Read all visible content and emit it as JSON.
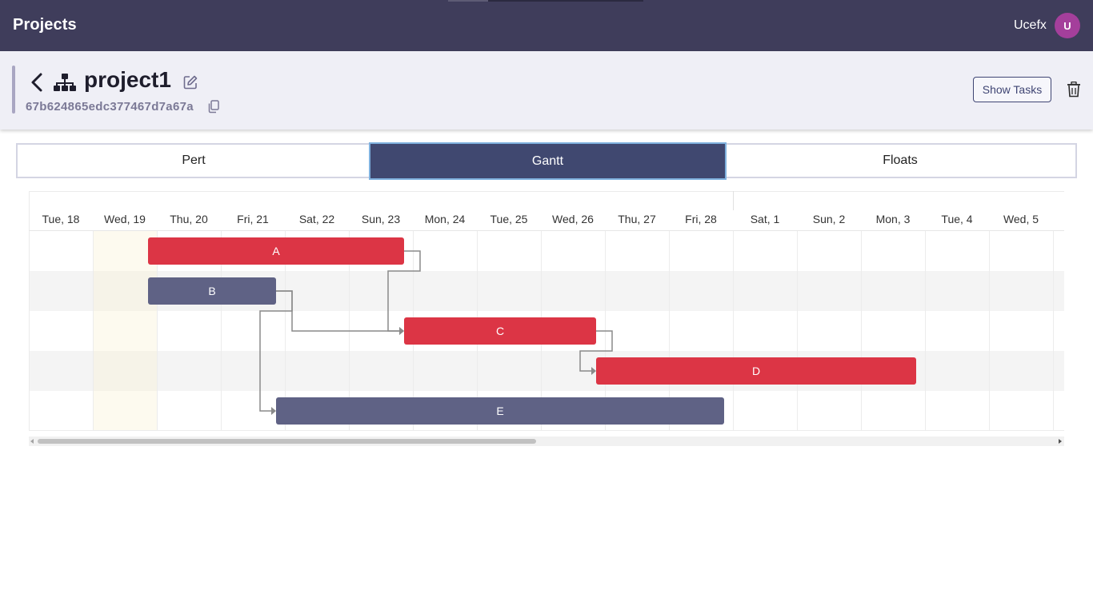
{
  "app": {
    "title": "Projects",
    "user_name": "Ucefx",
    "avatar_initial": "U",
    "avatar_color": "#a43f9b",
    "bar_color": "#3f3d5b"
  },
  "project": {
    "name": "project1",
    "id": "67b624865edc377467d7a67a",
    "show_tasks_label": "Show Tasks"
  },
  "tabs": [
    {
      "label": "Pert",
      "active": false
    },
    {
      "label": "Gantt",
      "active": true
    },
    {
      "label": "Floats",
      "active": false
    }
  ],
  "gantt": {
    "dates": [
      "Tue, 18",
      "Wed, 19",
      "Thu, 20",
      "Fri, 21",
      "Sat, 22",
      "Sun, 23",
      "Mon, 24",
      "Tue, 25",
      "Wed, 26",
      "Thu, 27",
      "Fri, 28",
      "Sat, 1",
      "Sun, 2",
      "Mon, 3",
      "Tue, 4",
      "Wed, 5"
    ],
    "today_column": 1,
    "critical_color": "#dc3545",
    "normal_color": "#5f6285",
    "tasks": [
      {
        "label": "A",
        "start_day": 1.8,
        "duration_days": 4,
        "critical": true
      },
      {
        "label": "B",
        "start_day": 1.8,
        "duration_days": 2,
        "critical": false
      },
      {
        "label": "C",
        "start_day": 5.8,
        "duration_days": 3,
        "critical": true
      },
      {
        "label": "D",
        "start_day": 8.8,
        "duration_days": 5,
        "critical": true
      },
      {
        "label": "E",
        "start_day": 3.8,
        "duration_days": 7,
        "critical": false
      }
    ],
    "dependencies": [
      {
        "from": "A",
        "to": "C"
      },
      {
        "from": "B",
        "to": "C"
      },
      {
        "from": "B",
        "to": "E"
      },
      {
        "from": "C",
        "to": "D"
      }
    ]
  }
}
